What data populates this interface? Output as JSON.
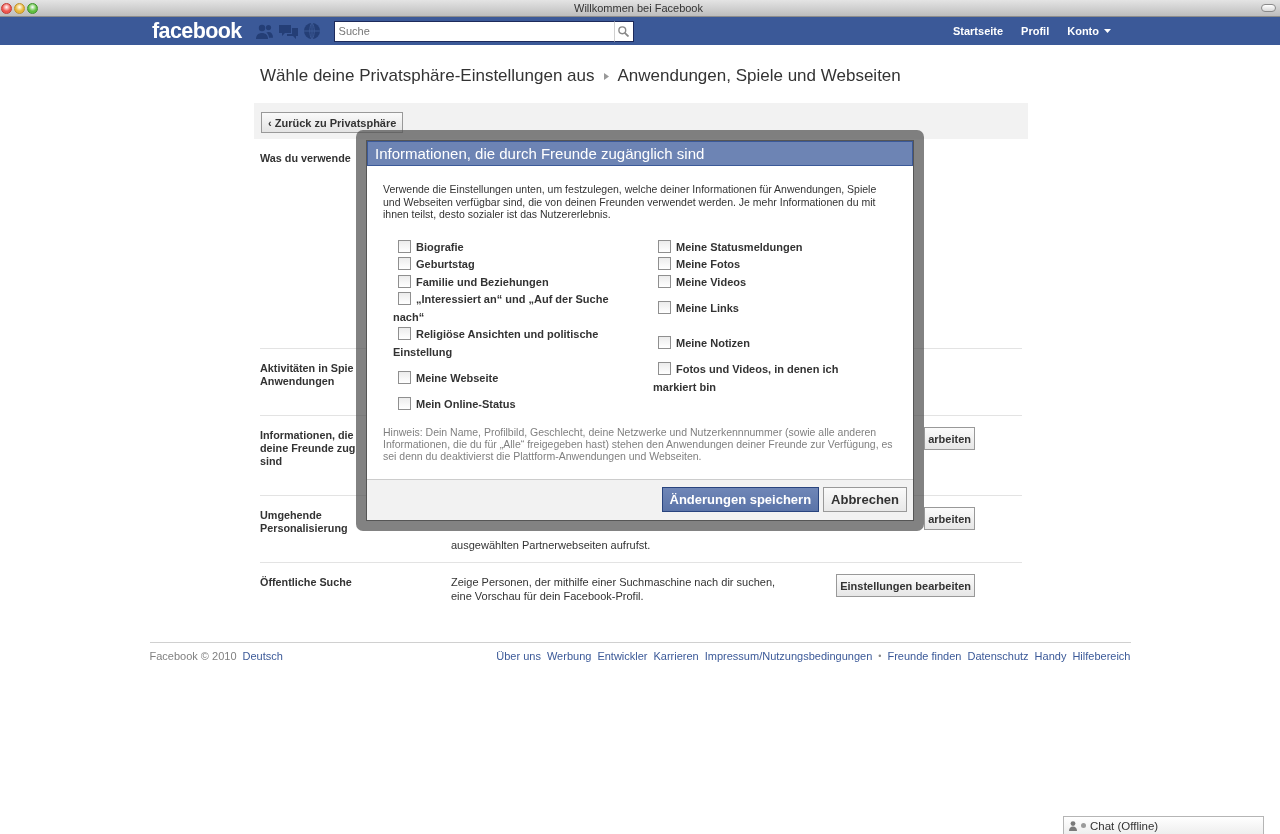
{
  "window": {
    "title": "Willkommen bei Facebook"
  },
  "top_bar": {
    "logo": "facebook",
    "search": {
      "placeholder": "Suche"
    },
    "nav": [
      {
        "label": "Startseite",
        "kind": "link"
      },
      {
        "label": "Profil",
        "kind": "link"
      },
      {
        "label": "Konto",
        "kind": "menu"
      }
    ]
  },
  "page": {
    "breadcrumb": [
      "Wähle deine Privatsphäre-Einstellungen aus",
      "Anwendungen, Spiele und Webseiten"
    ],
    "back_button": "‹ Zurück zu Privatsphäre",
    "rows": [
      {
        "label_lines": [
          "Was du verwende"
        ]
      },
      {
        "label_lines": [
          "Aktivitäten in Spie",
          "Anwendungen"
        ]
      },
      {
        "label_lines": [
          "Informationen, die",
          "deine Freunde zug",
          "sind"
        ],
        "button": "arbeiten"
      },
      {
        "label_lines": [
          "Umgehende",
          "Personalisierung"
        ],
        "description": "ausgewählten Partnerwebseiten aufrufst.",
        "button": "arbeiten"
      },
      {
        "label_lines": [
          "Öffentliche Suche"
        ],
        "description": "Zeige Personen, der mithilfe einer Suchmaschine nach dir suchen, eine Vorschau für dein Facebook-Profil.",
        "button": "Einstellungen bearbeiten"
      }
    ]
  },
  "dialog": {
    "title": "Informationen, die durch Freunde zugänglich sind",
    "intro": "Verwende die Einstellungen unten, um festzulegen, welche deiner Informationen für Anwendungen, Spiele und Webseiten verfügbar sind, die von deinen Freunden verwendet werden. Je mehr Informationen du mit ihnen teilst, desto sozialer ist das Nutzererlebnis.",
    "left_options": [
      {
        "label": "Biografie",
        "checked": false
      },
      {
        "label": "Geburtstag",
        "checked": false
      },
      {
        "label": "Familie und Beziehungen",
        "checked": false
      },
      {
        "label": "„Interessiert an“ und „Auf der Suche nach“",
        "checked": false
      },
      {
        "label": "Religiöse Ansichten und politische Einstellung",
        "checked": false
      },
      {
        "label": "Meine Webseite",
        "checked": false
      },
      {
        "label": "Mein Online-Status",
        "checked": false
      }
    ],
    "right_options": [
      {
        "label": "Meine Statusmeldungen",
        "checked": false
      },
      {
        "label": "Meine Fotos",
        "checked": false
      },
      {
        "label": "Meine Videos",
        "checked": false
      },
      {
        "label": "Meine Links",
        "checked": false
      },
      {
        "label": "Meine Notizen",
        "checked": false
      },
      {
        "label": "Fotos und Videos, in denen ich markiert bin",
        "checked": false
      }
    ],
    "hint": "Hinweis: Dein Name, Profilbild, Geschlecht, deine Netzwerke und Nutzerkennnummer (sowie alle anderen Informationen, die du für „Alle“ freigegeben hast) stehen den Anwendungen deiner Freunde zur Verfügung, es sei denn du deaktivierst die Plattform-Anwendungen und Webseiten.",
    "buttons": [
      {
        "label": "Änderungen speichern",
        "kind": "primary"
      },
      {
        "label": "Abbrechen",
        "kind": "secondary"
      }
    ]
  },
  "footer": {
    "copyright": "Facebook © 2010",
    "language": "Deutsch",
    "items": [
      {
        "kind": "link",
        "text": "Über uns"
      },
      {
        "kind": "link",
        "text": "Werbung"
      },
      {
        "kind": "link",
        "text": "Entwickler"
      },
      {
        "kind": "link",
        "text": "Karrieren"
      },
      {
        "kind": "link",
        "text": "Impressum/Nutzungsbedingungen"
      },
      {
        "kind": "separator",
        "text": "•"
      },
      {
        "kind": "link",
        "text": "Freunde finden"
      },
      {
        "kind": "link",
        "text": "Datenschutz"
      },
      {
        "kind": "link",
        "text": "Handy"
      },
      {
        "kind": "link",
        "text": "Hilfebereich"
      }
    ]
  },
  "chat": {
    "label": "Chat (Offline)"
  }
}
